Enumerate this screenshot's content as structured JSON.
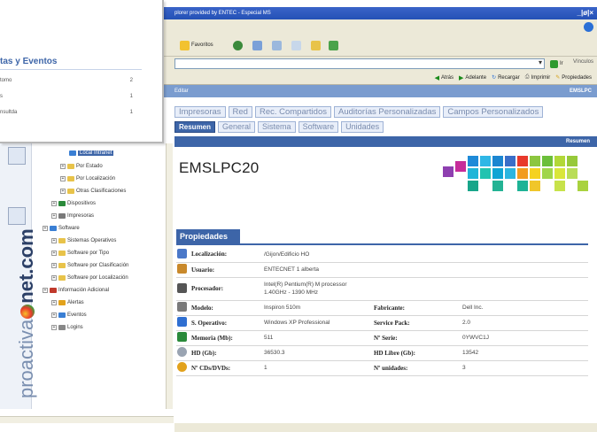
{
  "window": {
    "title": "plorer provided by ENTEC - Especial MS",
    "buttons": "_|ø|×"
  },
  "toolbar": {
    "favorites_label": "Favoritos"
  },
  "addressbar": {
    "go_label": "Ir",
    "links_label": "Vínculos"
  },
  "linksbar": {
    "back": "Atrás",
    "forward": "Adelante",
    "refresh": "Recargar",
    "print": "Imprimir",
    "properties": "Propiedades"
  },
  "appbar": {
    "left": "Editar",
    "right": "EMSLPC"
  },
  "tabs_row1": [
    "Impresoras",
    "Red",
    "Rec. Compartidos",
    "Auditorías Personalizadas",
    "Campos Personalizados"
  ],
  "tabs_row2": [
    "Resumen",
    "General",
    "Sistema",
    "Software",
    "Unidades"
  ],
  "resumen_label": "Resumen",
  "host": {
    "name": "EMSLPC20"
  },
  "properties": {
    "header": "Propiedades",
    "rows": [
      {
        "icon": "location-icon",
        "label": "Localización:",
        "value": "/Gijon/Edificio HO",
        "label2": "",
        "value2": ""
      },
      {
        "icon": "user-icon",
        "label": "Usuario:",
        "value": "ENTECNET 1 alberta",
        "label2": "",
        "value2": ""
      },
      {
        "icon": "processor-icon",
        "label": "Procesador:",
        "value": "Intel(R) Pentium(R) M processor 1.40GHz - 1390 MHz",
        "label2": "",
        "value2": ""
      },
      {
        "icon": "model-icon",
        "label": "Modelo:",
        "value": "Inspiron 510m",
        "label2": "Fabricante:",
        "value2": "Dell Inc."
      },
      {
        "icon": "os-icon",
        "label": "S. Operativo:",
        "value": "Windows XP Professional",
        "label2": "Service Pack:",
        "value2": "2.0"
      },
      {
        "icon": "memory-icon",
        "label": "Memoria (Mb):",
        "value": "511",
        "label2": "Nº Serie:",
        "value2": "0YWVC1J"
      },
      {
        "icon": "harddisk-icon",
        "label": "HD (Gb):",
        "value": "36530.3",
        "label2": "HD Libre (Gb):",
        "value2": "13542"
      },
      {
        "icon": "cdrom-icon",
        "label": "Nº CDs/DVDs:",
        "value": "1",
        "label2": "Nº unidades:",
        "value2": "3"
      }
    ]
  },
  "popup": {
    "title": "tas y Eventos",
    "rows": [
      {
        "label": "tomo",
        "count": "2"
      },
      {
        "label": "s",
        "count": "1"
      },
      {
        "label": "nsultda",
        "count": "1"
      }
    ]
  },
  "tree": [
    {
      "label": "Local Intranet",
      "indent": 3,
      "icon": "globe-icon",
      "selected": true
    },
    {
      "label": "Por Estado",
      "indent": 2,
      "icon": "folder-icon",
      "selected": false
    },
    {
      "label": "Por Localización",
      "indent": 2,
      "icon": "folder-icon",
      "selected": false
    },
    {
      "label": "Otras Clasificaciones",
      "indent": 2,
      "icon": "folder-icon",
      "selected": false
    },
    {
      "label": "Dispositivos",
      "indent": 1,
      "icon": "device-icon",
      "selected": false
    },
    {
      "label": "Impresoras",
      "indent": 1,
      "icon": "printer-icon",
      "selected": false
    },
    {
      "label": "Software",
      "indent": 0,
      "icon": "software-icon",
      "selected": false
    },
    {
      "label": "Sistemas Operativos",
      "indent": 1,
      "icon": "folder-icon",
      "selected": false
    },
    {
      "label": "Software por Tipo",
      "indent": 1,
      "icon": "folder-icon",
      "selected": false
    },
    {
      "label": "Software por Clasificación",
      "indent": 1,
      "icon": "folder-icon",
      "selected": false
    },
    {
      "label": "Software por Localización",
      "indent": 1,
      "icon": "folder-icon",
      "selected": false
    },
    {
      "label": "Información Adicional",
      "indent": 0,
      "icon": "info-icon",
      "selected": false
    },
    {
      "label": "Alertas",
      "indent": 1,
      "icon": "alert-icon",
      "selected": false
    },
    {
      "label": "Eventos",
      "indent": 1,
      "icon": "event-icon",
      "selected": false
    },
    {
      "label": "Logins",
      "indent": 1,
      "icon": "login-icon",
      "selected": false
    }
  ],
  "brand": {
    "text_light": "proactiva",
    "text_dark": "net.com"
  },
  "colors": {
    "accent": "#3d65a8",
    "titlebar": "#2451b6"
  }
}
